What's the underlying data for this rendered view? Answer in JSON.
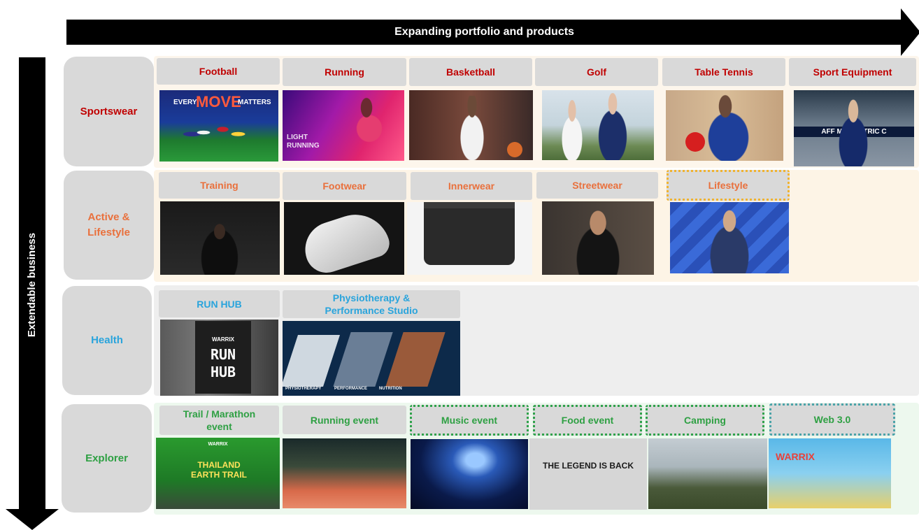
{
  "top_arrow": {
    "label": "Expanding portfolio and products"
  },
  "side_arrow": {
    "label": "Extendable business"
  },
  "rows": {
    "sportswear": {
      "label": "Sportswear",
      "categories": [
        "Football",
        "Running",
        "Basketball",
        "Golf",
        "Table Tennis",
        "Sport Equipment"
      ]
    },
    "active": {
      "label": "Active & Lifestyle",
      "categories": [
        "Training",
        "Footwear",
        "Innerwear",
        "Streetwear",
        "Lifestyle"
      ]
    },
    "health": {
      "label": "Health",
      "categories": [
        "RUN HUB",
        "Physiotherapy & Performance Studio"
      ]
    },
    "explorer": {
      "label": "Explorer",
      "categories": [
        "Trail / Marathon event",
        "Running event",
        "Music event",
        "Food event",
        "Camping",
        "Web 3.0"
      ]
    }
  },
  "photo_texts": {
    "football_banner_left": "EVERY",
    "football_banner_mid": "MOVE",
    "football_banner_right": "MATTERS",
    "running_banner": "LIGHT RUNNING",
    "sport_equipment_banner": "AFF M        ELECTRIC C",
    "runhub_brand": "WARRIX",
    "runhub_sign": "RUN HUB",
    "physio_labels": [
      "PHYSIOTHERAPY",
      "PERFORMANCE",
      "NUTRITION"
    ],
    "trail_brand": "WARRIX",
    "trail_title": "THAILAND EARTH TRAIL",
    "food_title": "THE LEGEND IS BACK",
    "web3_title": "WARRIX"
  },
  "colors": {
    "sportswear": "#c00000",
    "active": "#e9703c",
    "health": "#29a4dc",
    "explorer": "#2ea043"
  }
}
